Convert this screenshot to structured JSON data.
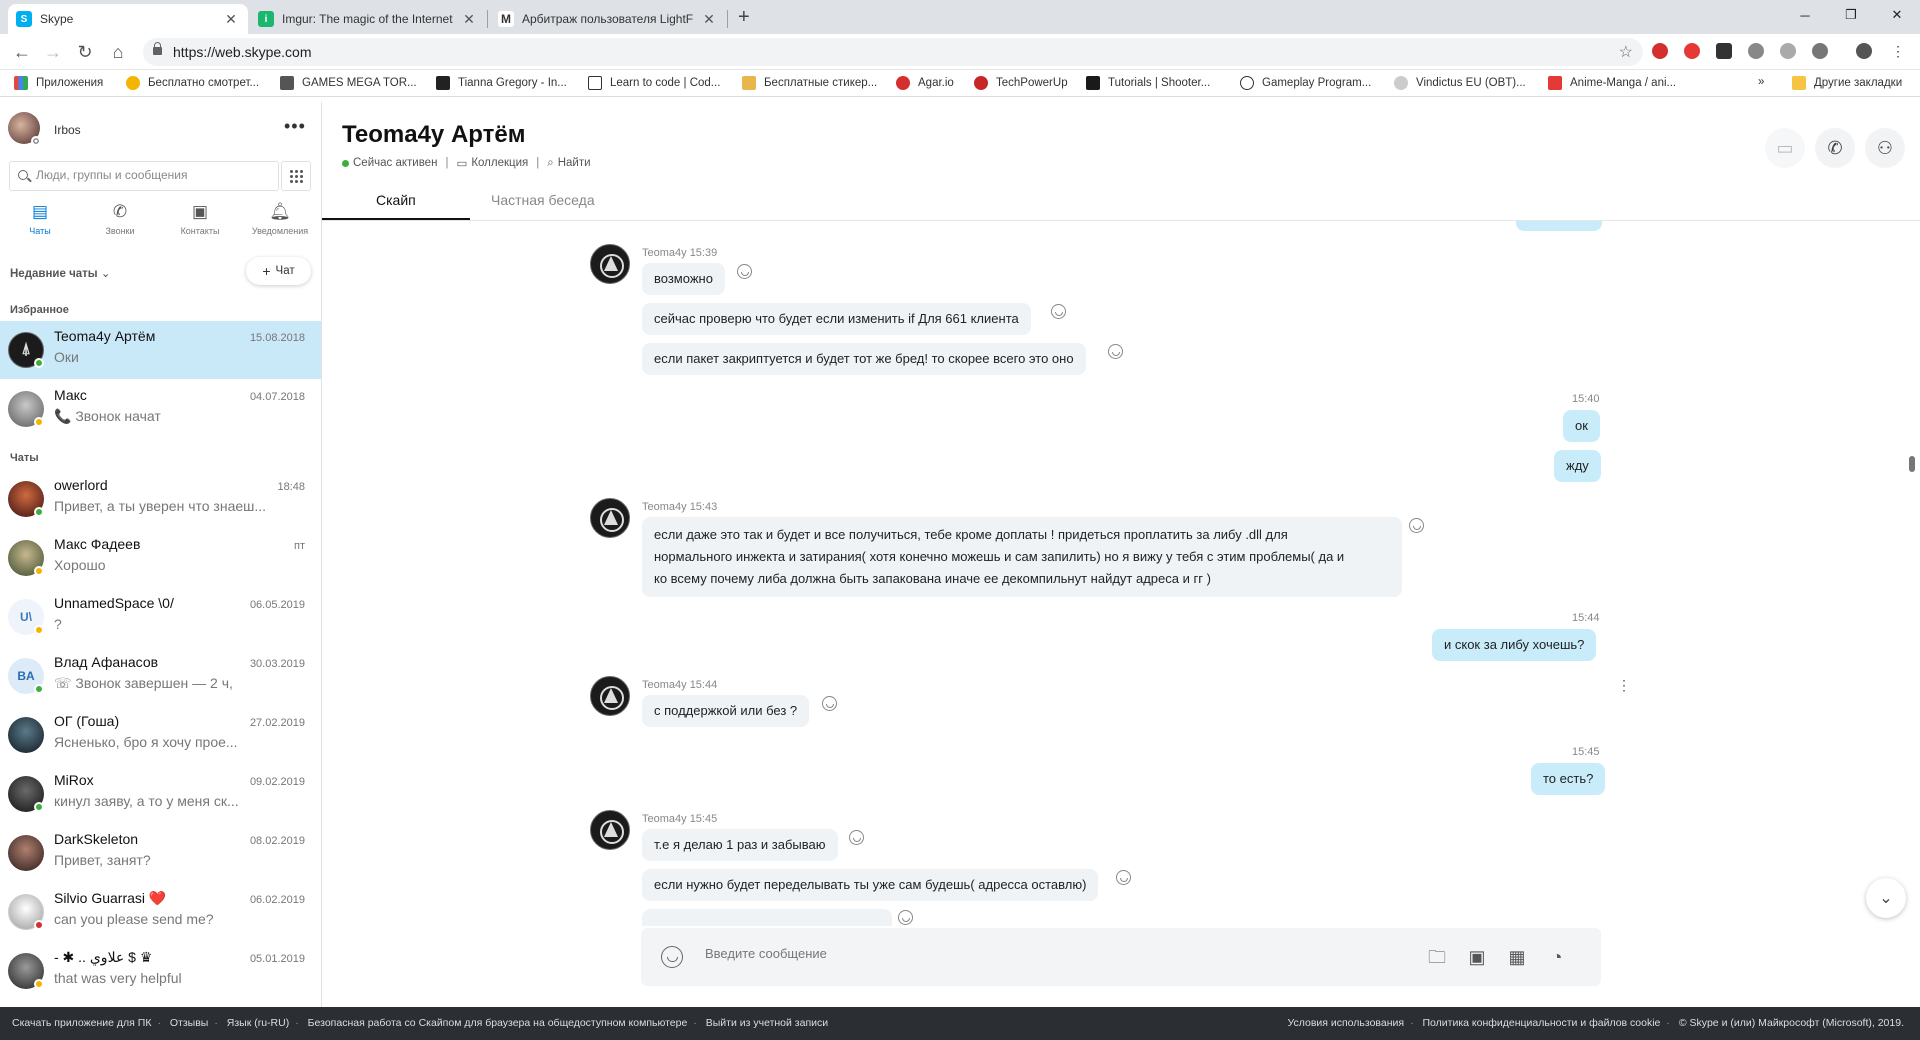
{
  "browser": {
    "tabs": [
      {
        "title": "Skype",
        "active": true,
        "favicon": "skype-icon",
        "color": "#00aff0"
      },
      {
        "title": "Imgur: The magic of the Internet",
        "active": false,
        "favicon": "imgur-icon",
        "color": "#1bb76e"
      },
      {
        "title": "Арбитраж пользователя LightF",
        "active": false,
        "favicon": "m-icon",
        "color": "#444444"
      }
    ],
    "url": "https://web.skype.com",
    "bookmarks": [
      {
        "label": "Приложения",
        "color": "#e2483d"
      },
      {
        "label": "Бесплатно смотрет...",
        "color": "#f4b400"
      },
      {
        "label": "GAMES MEGA TOR...",
        "color": "#555555"
      },
      {
        "label": "Tianna Gregory - In...",
        "color": "#222222"
      },
      {
        "label": "Learn to code | Cod...",
        "color": "#333333"
      },
      {
        "label": "Бесплатные стикер...",
        "color": "#e8b64c"
      },
      {
        "label": "Agar.io",
        "color": "#d32f2f"
      },
      {
        "label": "TechPowerUp",
        "color": "#c62828"
      },
      {
        "label": "Tutorials | Shooter...",
        "color": "#1a1a1a"
      },
      {
        "label": "Gameplay Program...",
        "color": "#333333"
      },
      {
        "label": "Vindictus EU (OBT)...",
        "color": "#888888"
      },
      {
        "label": "Anime-Manga / ani...",
        "color": "#e53935"
      }
    ],
    "more": "»",
    "other_bookmarks": "Другие закладки"
  },
  "sidebar": {
    "username": "Irbos",
    "search_placeholder": "Люди, группы и сообщения",
    "nav": [
      {
        "label": "Чаты",
        "icon": "chat-icon",
        "active": true
      },
      {
        "label": "Звонки",
        "icon": "phone-icon",
        "active": false
      },
      {
        "label": "Контакты",
        "icon": "contacts-icon",
        "active": false
      },
      {
        "label": "Уведомления",
        "icon": "bell-icon",
        "active": false
      }
    ],
    "recent_label": "Недавние чаты",
    "new_chat_label": "Чат",
    "favorites_label": "Избранное",
    "chats_label": "Чаты",
    "favorites": [
      {
        "name": "Teoma4y Артём",
        "preview": "Оки",
        "date": "15.08.2018",
        "avatar_color": "#1b1b1b",
        "initials": "",
        "status_color": "#3bb03b",
        "active": true
      },
      {
        "name": "Макс",
        "preview": "📞 Звонок начат",
        "date": "04.07.2018",
        "avatar_color": "#8d8d8d",
        "initials": "",
        "status_color": "#f5b301",
        "active": false
      }
    ],
    "chats": [
      {
        "name": "owerlord",
        "preview": "Привет, а ты уверен что знаеш...",
        "date": "18:48",
        "avatar_color": "#7a2b1f",
        "initials": "",
        "status_color": "#3bb03b"
      },
      {
        "name": "Макс Фадеев",
        "preview": "Хорошо",
        "date": "пт",
        "avatar_color": "#6b7a4a",
        "initials": "",
        "status_color": "#f5b301"
      },
      {
        "name": "UnnamedSpace \\0/",
        "preview": "?",
        "date": "06.05.2019",
        "avatar_color": "#eef4fa",
        "initials": "U\\",
        "status_color": "#f5b301"
      },
      {
        "name": "Влад Афанасов",
        "preview": "Звонок завершен — 2 ч,",
        "date": "30.03.2019",
        "avatar_color": "#dcebf7",
        "initials": "BA",
        "status_color": "#3bb03b"
      },
      {
        "name": "ОГ (Гоша)",
        "preview": "Ясненько, бро я хочу прое...",
        "date": "27.02.2019",
        "avatar_color": "#22303a",
        "initials": "",
        "status_color": ""
      },
      {
        "name": "MiRox",
        "preview": "кинул заяву, а то у меня ск...",
        "date": "09.02.2019",
        "avatar_color": "#2a2a2a",
        "initials": "",
        "status_color": "#3bb03b"
      },
      {
        "name": "DarkSkeleton",
        "preview": "Привет, занят?",
        "date": "08.02.2019",
        "avatar_color": "#5a3a3a",
        "initials": "",
        "status_color": ""
      },
      {
        "name": "Silvio Guarrasi ❤️",
        "preview": "can you please send me?",
        "date": "06.02.2019",
        "avatar_color": "#f0f0f0",
        "initials": "",
        "status_color": "#d32f2f"
      },
      {
        "name": "- ✱ .. علاوي $ ♛",
        "preview": "that was very helpful",
        "date": "05.01.2019",
        "avatar_color": "#4a4a4a",
        "initials": "",
        "status_color": "#f5b301"
      }
    ]
  },
  "chat": {
    "name": "Teoma4y Артём",
    "status": "Сейчас активен",
    "collection": "Коллекция",
    "find": "Найти",
    "tabs": [
      "Скайп",
      "Частная беседа"
    ],
    "composer_placeholder": "Введите сообщение",
    "messages": {
      "g1_meta": "Teoma4y 15:39",
      "g1_m1": "возможно",
      "g1_m2": "сейчас проверю что будет если изменить if Для 661 клиента",
      "g1_m3": "если пакет закриптуется и будет тот же бред! то скорее всего это оно",
      "o1_time": "15:40",
      "o1_m1": "ок",
      "o1_m2": "жду",
      "g2_meta": "Teoma4y 15:43",
      "g2_l1": "если даже это так и будет и все получиться, тебе кроме доплаты ! придеться проплатить за либу .dll для",
      "g2_l2": "нормального инжекта и затирания( хотя конечно можешь и сам запилить) но я вижу у тебя с этим проблемы( да и",
      "g2_l3": "ко всему почему либа должна быть запакована иначе ее декомпильнут найдут адреса и гг )",
      "o2_time": "15:44",
      "o2_m1": "и скок за либу хочешь?",
      "g3_meta": "Teoma4y 15:44",
      "g3_m1": "с поддержкой или без ?",
      "o3_time": "15:45",
      "o3_m1": "то есть?",
      "g4_meta": "Teoma4y 15:45",
      "g4_m1": "т.е я делаю 1 раз и забываю",
      "g4_m2": "если нужно будет переделывать ты уже сам будешь( адресса оставлю)"
    }
  },
  "footer": {
    "left": [
      "Скачать приложение для ПК",
      "Отзывы",
      "Язык (ru-RU)",
      "Безопасная работа со Скайпом для браузера на общедоступном компьютере",
      "Выйти из учетной записи"
    ],
    "right": [
      "Условия использования",
      "Политика конфиденциальности и файлов cookie",
      "© Skype и (или) Майкрософт (Microsoft), 2019."
    ]
  }
}
